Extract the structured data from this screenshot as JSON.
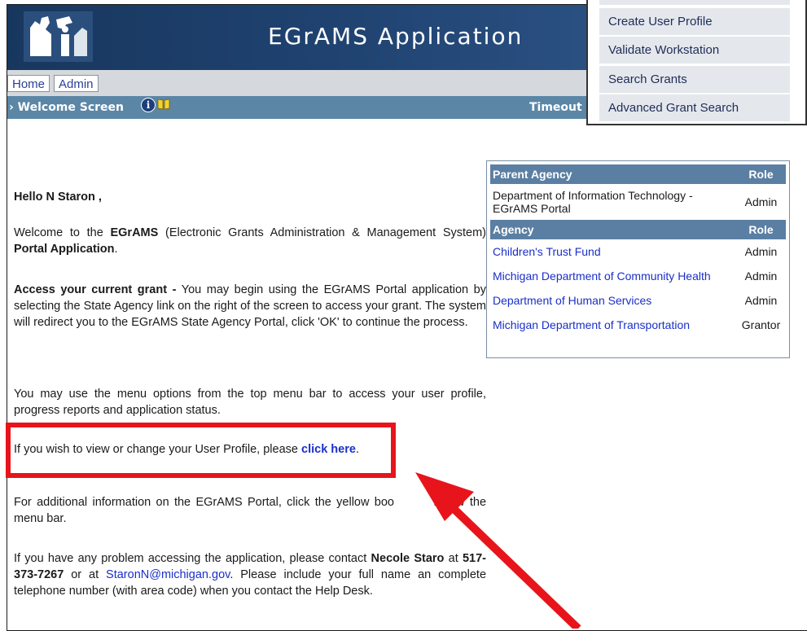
{
  "header": {
    "app_title": "EGrAMS Application"
  },
  "nav": {
    "items": [
      {
        "label": "Home"
      },
      {
        "label": "Admin"
      }
    ]
  },
  "titlebar": {
    "screen_title": "Welcome Screen",
    "timeout_label": "Timeout L"
  },
  "menu": {
    "items": [
      {
        "label": "Create User Profile"
      },
      {
        "label": "Validate Workstation"
      },
      {
        "label": "Search Grants"
      },
      {
        "label": "Advanced Grant Search"
      }
    ]
  },
  "content": {
    "greeting": "Hello N Staron ,",
    "welcome_pre": "Welcome to the",
    "welcome_brand": "EGrAMS",
    "welcome_mid": "(Electronic Grants Administration & Management System)",
    "welcome_bold": "Portal Application",
    "welcome_end": ".",
    "access_heading": "Access your current grant -",
    "access_text": "You may begin using the EGrAMS Portal application by selecting the State Agency link on the right of the screen to access your grant. The system will redirect you to the EGrAMS State Agency Portal, click 'OK' to continue the process.",
    "menu_options_text": "You may use the menu options from the top menu bar to access your user profile, progress reports and application status.",
    "profile_text": "If you wish to view or change your User Profile, please",
    "profile_link": "click here",
    "profile_end": ".",
    "additional_text": "For additional information on the EGrAMS Portal, click the yellow boo",
    "additional_end": "below the menu bar.",
    "problem_text_1": "If you have any problem accessing the application, please contact",
    "contact_name": "Necole Staro",
    "contact_at": "at",
    "contact_phone": "517-373-7267",
    "or_at": "or at",
    "contact_email": "StaronN@michigan.gov",
    "problem_text_2": ". Please include your full name an",
    "problem_text_3": "complete telephone number (with area code) when you contact the Help Desk."
  },
  "agency_table": {
    "parent_header": "Parent Agency",
    "role_header": "Role",
    "parent_rows": [
      {
        "agency": "Department of Information Technology - EGrAMS Portal",
        "role": "Admin"
      }
    ],
    "agency_header": "Agency",
    "agency_rows": [
      {
        "agency": "Children's Trust Fund",
        "role": "Admin"
      },
      {
        "agency": "Michigan Department of Community Health",
        "role": "Admin"
      },
      {
        "agency": "Department of Human Services",
        "role": "Admin"
      },
      {
        "agency": "Michigan Department of Transportation",
        "role": "Grantor"
      }
    ]
  },
  "colors": {
    "banner": "#1f4270",
    "titlebar": "#5b86a6",
    "highlight": "#e8141b",
    "link": "#1a2fc9"
  }
}
